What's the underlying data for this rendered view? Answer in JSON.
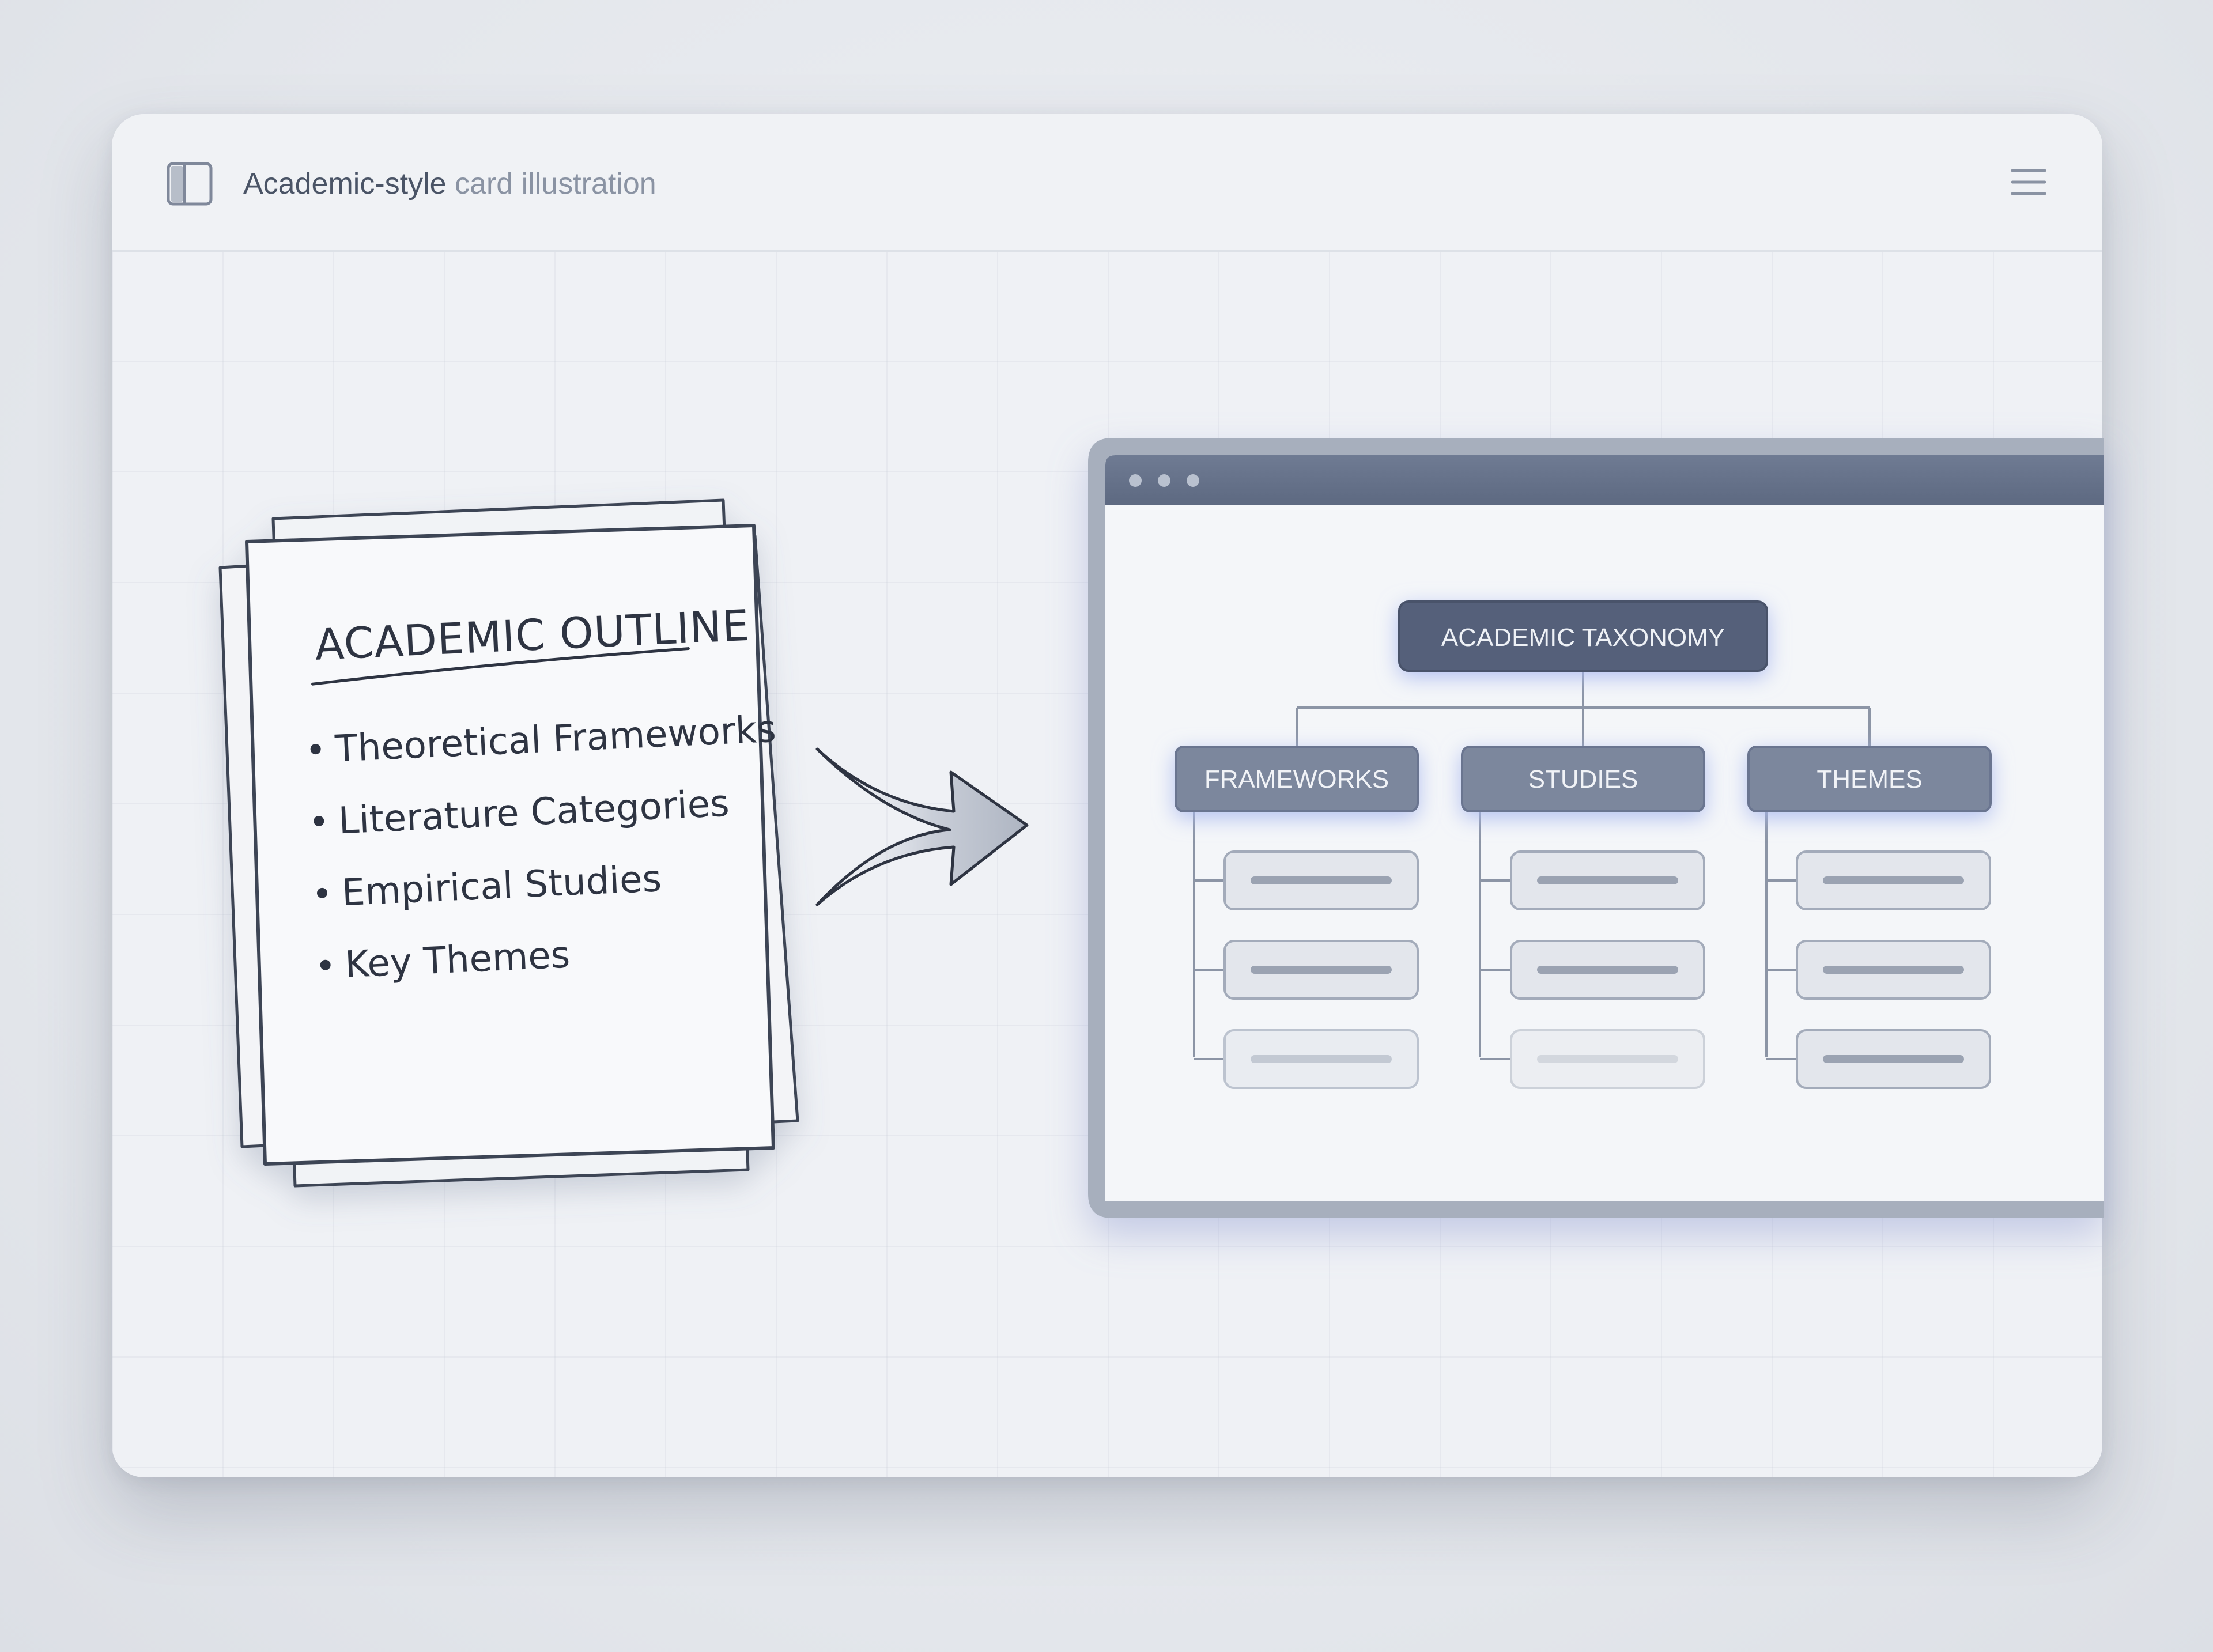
{
  "header": {
    "title_strong": "Academic-style",
    "title_light": "card illustration",
    "icon": "sidebar-panel-icon",
    "menu_icon": "hamburger-menu-icon"
  },
  "outline": {
    "title": "ACADEMIC OUTLINE",
    "items": [
      "Theoretical Frameworks",
      "Literature Categories",
      "Empirical Studies",
      "Key Themes"
    ]
  },
  "arrow_icon": "right-arrow-icon",
  "window": {
    "root": "ACADEMIC TAXONOMY",
    "branches": [
      "FRAMEWORKS",
      "STUDIES",
      "THEMES"
    ]
  },
  "colors": {
    "accent": "#5d6a85",
    "node_dark": "#57637a",
    "node_mid": "#7c879d",
    "glow": "#a9b8ee"
  }
}
